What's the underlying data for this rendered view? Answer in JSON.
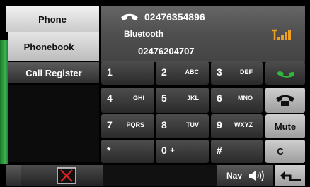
{
  "sidebar": {
    "phone_label": "Phone",
    "phonebook_label": "Phonebook",
    "call_register_label": "Call Register"
  },
  "header": {
    "caller_number": "02476354896",
    "source_label": "Bluetooth",
    "own_number": "02476204707",
    "signal_icon": "signal-strength-icon",
    "phone_icon": "handset-icon"
  },
  "keypad": {
    "keys": [
      {
        "num": "1",
        "letters": ""
      },
      {
        "num": "2",
        "letters": "ABC"
      },
      {
        "num": "3",
        "letters": "DEF"
      },
      {
        "num": "4",
        "letters": "GHI"
      },
      {
        "num": "5",
        "letters": "JKL"
      },
      {
        "num": "6",
        "letters": "MNO"
      },
      {
        "num": "7",
        "letters": "PQRS"
      },
      {
        "num": "8",
        "letters": "TUV"
      },
      {
        "num": "9",
        "letters": "WXYZ"
      },
      {
        "num": "*",
        "letters": ""
      },
      {
        "num": "0",
        "letters": "+"
      },
      {
        "num": "#",
        "letters": ""
      }
    ]
  },
  "right_panel": {
    "call_icon": "call-icon",
    "hangup_icon": "hang-up-icon",
    "mute_label": "Mute",
    "clear_label": "C"
  },
  "footer": {
    "close_icon": "close-icon",
    "nav_label": "Nav",
    "speaker_icon": "speaker-icon",
    "back_icon": "return-icon"
  },
  "colors": {
    "accent_green": "#3fb24f",
    "signal_orange": "#f0a020",
    "close_red": "#e02020"
  }
}
